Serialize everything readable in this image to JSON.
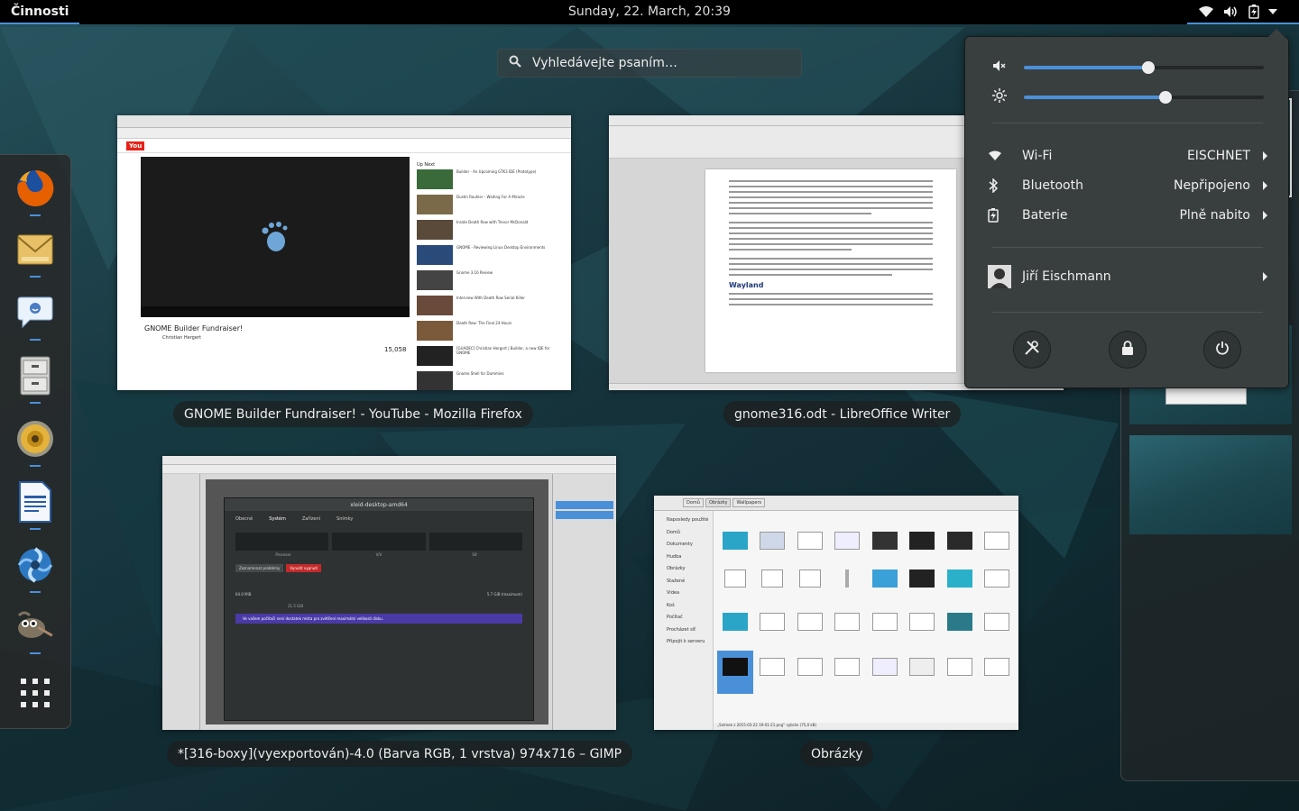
{
  "topbar": {
    "activities": "Činnosti",
    "clock": "Sunday, 22. March, 20:39",
    "status_icons": [
      "wifi-icon",
      "volume-icon",
      "battery-charging-icon",
      "menu-arrow-icon"
    ]
  },
  "search": {
    "placeholder": "Vyhledávejte psaním…"
  },
  "dash": {
    "apps": [
      {
        "name": "Firefox",
        "icon": "firefox-icon",
        "running": true
      },
      {
        "name": "Evolution",
        "icon": "mail-icon",
        "running": true
      },
      {
        "name": "Empathy",
        "icon": "chat-icon",
        "running": true
      },
      {
        "name": "Files",
        "icon": "file-cabinet-icon",
        "running": true
      },
      {
        "name": "Rhythmbox",
        "icon": "speaker-icon",
        "running": true
      },
      {
        "name": "LibreOffice Writer",
        "icon": "writer-icon",
        "running": true
      },
      {
        "name": "Shotwell",
        "icon": "shotwell-icon",
        "running": true
      },
      {
        "name": "GIMP",
        "icon": "gimp-icon",
        "running": true
      },
      {
        "name": "Show Applications",
        "icon": "app-grid-icon",
        "running": false
      }
    ]
  },
  "windows": [
    {
      "caption": "GNOME Builder Fundraiser! - YouTube - Mozilla Firefox",
      "video_title": "GNOME Builder Fundraiser!",
      "channel": "Christian Hergert",
      "views": "15,058",
      "up_next": "Up Next",
      "side_videos": [
        "Builder - An Upcoming GTK3 IDE (Prototype)",
        "Dustin Rouhier - Waiting For A Miracle",
        "Inside Death Row with Trevor McDonald",
        "GNOME - Reviewing Linux Desktop Environments",
        "Gnome 3.16 Review",
        "Interview With Death Row Serial Killer",
        "Death Row: The Final 24 Hours",
        "[GUADEC] Christian Hergert | Builder, a new IDE for GNOME",
        "Gnome Shell for Dummies"
      ]
    },
    {
      "caption": "gnome316.odt - LibreOffice Writer",
      "doc_heading": "Wayland"
    },
    {
      "caption": "*[316-boxy](vyexportován)-4.0 (Barva RGB, 1 vrstva) 974x716 – GIMP",
      "dialog_title": "xleid-desktop-amd64",
      "dialog_tabs": [
        "Obecné",
        "Systém",
        "Zařízení",
        "Snímky"
      ],
      "labels": [
        "Procesor",
        "V/V",
        "Síť"
      ],
      "buttons": [
        "Zaznamenat problémy",
        "Vynutit vypnutí"
      ],
      "ram": "64.0 MiB",
      "disk": "5.7 GiB (maximum)",
      "max_disk": "21.5 GiB",
      "warning": "Ve vašem počítači není dostatek místa pro zvětšení maximální velikosti disku."
    },
    {
      "caption": "Obrázky",
      "path": [
        "Domů",
        "Obrázky",
        "Wallpapers"
      ],
      "sidebar": [
        "Naposledy použité",
        "Domů",
        "Dokumenty",
        "Hudba",
        "Obrázky",
        "Stažené",
        "Videa",
        "Koš",
        "Počítač",
        "Procházet síť",
        "Připojit k serveru"
      ],
      "status": "„Snímek z 2015-03-22 19-01-21.png“ vybrán (75,0 kB)"
    }
  ],
  "system_menu": {
    "volume_level": 0.52,
    "brightness_level": 0.59,
    "rows": [
      {
        "icon": "wifi-icon",
        "label": "Wi-Fi",
        "value": "EISCHNET"
      },
      {
        "icon": "bluetooth-icon",
        "label": "Bluetooth",
        "value": "Nepřipojeno"
      },
      {
        "icon": "battery-icon",
        "label": "Baterie",
        "value": "Plně nabito"
      }
    ],
    "user": "Jiří Eischmann",
    "actions": [
      "settings-icon",
      "lock-icon",
      "power-icon"
    ]
  },
  "colors": {
    "accent": "#4a90d9",
    "menu_bg": "#393f3f",
    "topbar_bg": "#000000"
  }
}
